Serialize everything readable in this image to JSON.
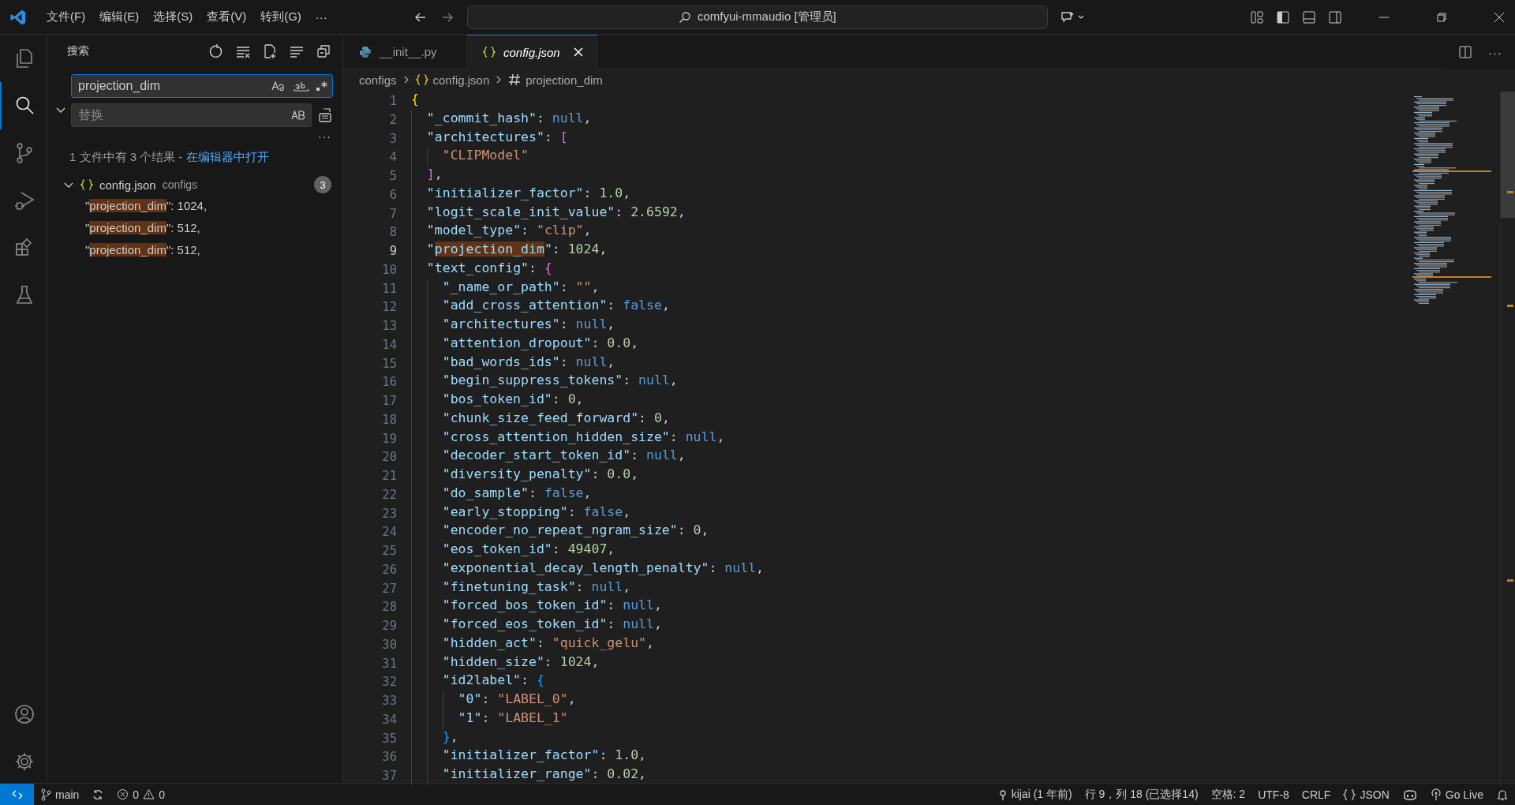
{
  "title_bar": {
    "menu": [
      "文件(F)",
      "编辑(E)",
      "选择(S)",
      "查看(V)",
      "转到(G)"
    ],
    "more": "···",
    "command_center": "comfyui-mmaudio [管理员]"
  },
  "activity_bar": [
    {
      "kind": "files",
      "selected": false
    },
    {
      "kind": "search",
      "selected": true
    },
    {
      "kind": "branch",
      "selected": false
    },
    {
      "kind": "debug",
      "selected": false
    },
    {
      "kind": "extensions",
      "selected": false
    },
    {
      "kind": "flask",
      "selected": false
    }
  ],
  "activity_bar_bottom": [
    {
      "kind": "account"
    },
    {
      "kind": "gear"
    }
  ],
  "sidebar": {
    "title": "搜索",
    "search": {
      "value": "projection_dim"
    },
    "replace": {
      "placeholder": "替换"
    },
    "more": "···",
    "summary": "1 文件中有 3 个结果 - ",
    "open_link": "在编辑器中打开",
    "file": {
      "name": "config.json",
      "folder": "configs",
      "count": "3",
      "expanded": true,
      "results": [
        {
          "before": "\"",
          "match": "projection_dim",
          "after": "\": 1024,"
        },
        {
          "before": "\"",
          "match": "projection_dim",
          "after": "\": 512,"
        },
        {
          "before": "\"",
          "match": "projection_dim",
          "after": "\": 512,"
        }
      ]
    }
  },
  "tabs": [
    {
      "label": "__init__.py",
      "kind": "python",
      "selected": false
    },
    {
      "label": "config.json",
      "kind": "json",
      "selected": true
    }
  ],
  "breadcrumb": [
    {
      "label": "configs",
      "kind": "folder"
    },
    {
      "label": "config.json",
      "kind": "json"
    },
    {
      "label": "projection_dim",
      "kind": "field"
    }
  ],
  "editor": {
    "lines": [
      {
        "number": "1",
        "text": "{",
        "current": false
      },
      {
        "number": "2",
        "text": "  \"_commit_hash\": null,",
        "current": false
      },
      {
        "number": "3",
        "text": "  \"architectures\": [",
        "current": false
      },
      {
        "number": "4",
        "text": "    \"CLIPModel\"",
        "current": false
      },
      {
        "number": "5",
        "text": "  ],",
        "current": false
      },
      {
        "number": "6",
        "text": "  \"initializer_factor\": 1.0,",
        "current": false
      },
      {
        "number": "7",
        "text": "  \"logit_scale_init_value\": 2.6592,",
        "current": false
      },
      {
        "number": "8",
        "text": "  \"model_type\": \"clip\",",
        "current": false
      },
      {
        "number": "9",
        "text": "  \"projection_dim\": 1024,",
        "current": true
      },
      {
        "number": "10",
        "text": "  \"text_config\": {",
        "current": false
      },
      {
        "number": "11",
        "text": "    \"_name_or_path\": \"\",",
        "current": false
      },
      {
        "number": "12",
        "text": "    \"add_cross_attention\": false,",
        "current": false
      },
      {
        "number": "13",
        "text": "    \"architectures\": null,",
        "current": false
      },
      {
        "number": "14",
        "text": "    \"attention_dropout\": 0.0,",
        "current": false
      },
      {
        "number": "15",
        "text": "    \"bad_words_ids\": null,",
        "current": false
      },
      {
        "number": "16",
        "text": "    \"begin_suppress_tokens\": null,",
        "current": false
      },
      {
        "number": "17",
        "text": "    \"bos_token_id\": 0,",
        "current": false
      },
      {
        "number": "18",
        "text": "    \"chunk_size_feed_forward\": 0,",
        "current": false
      },
      {
        "number": "19",
        "text": "    \"cross_attention_hidden_size\": null,",
        "current": false
      },
      {
        "number": "20",
        "text": "    \"decoder_start_token_id\": null,",
        "current": false
      },
      {
        "number": "21",
        "text": "    \"diversity_penalty\": 0.0,",
        "current": false
      },
      {
        "number": "22",
        "text": "    \"do_sample\": false,",
        "current": false
      },
      {
        "number": "23",
        "text": "    \"early_stopping\": false,",
        "current": false
      },
      {
        "number": "24",
        "text": "    \"encoder_no_repeat_ngram_size\": 0,",
        "current": false
      },
      {
        "number": "25",
        "text": "    \"eos_token_id\": 49407,",
        "current": false
      },
      {
        "number": "26",
        "text": "    \"exponential_decay_length_penalty\": null,",
        "current": false
      },
      {
        "number": "27",
        "text": "    \"finetuning_task\": null,",
        "current": false
      },
      {
        "number": "28",
        "text": "    \"forced_bos_token_id\": null,",
        "current": false
      },
      {
        "number": "29",
        "text": "    \"forced_eos_token_id\": null,",
        "current": false
      },
      {
        "number": "30",
        "text": "    \"hidden_act\": \"quick_gelu\",",
        "current": false
      },
      {
        "number": "31",
        "text": "    \"hidden_size\": 1024,",
        "current": false
      },
      {
        "number": "32",
        "text": "    \"id2label\": {",
        "current": false
      },
      {
        "number": "33",
        "text": "      \"0\": \"LABEL_0\",",
        "current": false
      },
      {
        "number": "34",
        "text": "      \"1\": \"LABEL_1\"",
        "current": false
      },
      {
        "number": "35",
        "text": "    },",
        "current": false
      },
      {
        "number": "36",
        "text": "    \"initializer_factor\": 1.0,",
        "current": false
      },
      {
        "number": "37",
        "text": "    \"initializer_range\": 0.02,",
        "current": false
      }
    ]
  },
  "status_bar": {
    "branch": "main",
    "errors": "0",
    "warnings": "0",
    "blame": "kijai (1 年前)",
    "position": "行 9，列 18 (已选择14)",
    "indent": "空格: 2",
    "encoding": "UTF-8",
    "eol": "CRLF",
    "language": "JSON",
    "live": "Go Live"
  }
}
